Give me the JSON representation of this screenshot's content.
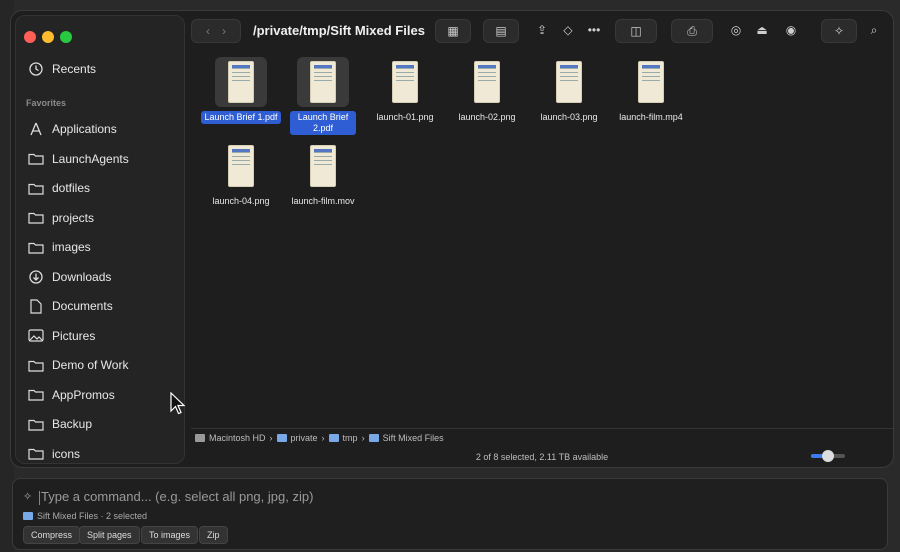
{
  "window": {
    "title": "/private/tmp/Sift Mixed Files"
  },
  "sidebar": {
    "recents_label": "Recents",
    "favorites_heading": "Favorites",
    "items": [
      {
        "label": "Applications",
        "icon": "applications-icon"
      },
      {
        "label": "LaunchAgents",
        "icon": "folder-icon"
      },
      {
        "label": "dotfiles",
        "icon": "folder-icon"
      },
      {
        "label": "projects",
        "icon": "folder-icon"
      },
      {
        "label": "images",
        "icon": "folder-icon"
      },
      {
        "label": "Downloads",
        "icon": "downloads-icon"
      },
      {
        "label": "Documents",
        "icon": "document-icon"
      },
      {
        "label": "Pictures",
        "icon": "pictures-icon"
      },
      {
        "label": "Demo of Work",
        "icon": "folder-icon"
      },
      {
        "label": "AppPromos",
        "icon": "folder-icon"
      },
      {
        "label": "Backup",
        "icon": "folder-icon"
      },
      {
        "label": "icons",
        "icon": "folder-icon"
      }
    ]
  },
  "files": [
    {
      "name": "Launch Brief 1.pdf",
      "selected": true
    },
    {
      "name": "Launch Brief 2.pdf",
      "selected": true
    },
    {
      "name": "launch-01.png",
      "selected": false
    },
    {
      "name": "launch-02.png",
      "selected": false
    },
    {
      "name": "launch-03.png",
      "selected": false
    },
    {
      "name": "launch-film.mp4",
      "selected": false
    },
    {
      "name": "launch-04.png",
      "selected": false
    },
    {
      "name": "launch-film.mov",
      "selected": false
    }
  ],
  "pathbar": [
    "Macintosh HD",
    "private",
    "tmp",
    "Sift Mixed Files"
  ],
  "status": {
    "text": "2 of 8 selected, 2.11 TB available",
    "zoom_fraction": 0.5
  },
  "command_bar": {
    "placeholder": "Type a command...  (e.g. select all png, jpg, zip)",
    "context": "Sift Mixed Files · 2 selected",
    "chips": [
      "Compress",
      "Split pages",
      "To images",
      "Zip"
    ]
  },
  "colors": {
    "selection": "#2f5ed4",
    "accent": "#3c7bf0"
  }
}
